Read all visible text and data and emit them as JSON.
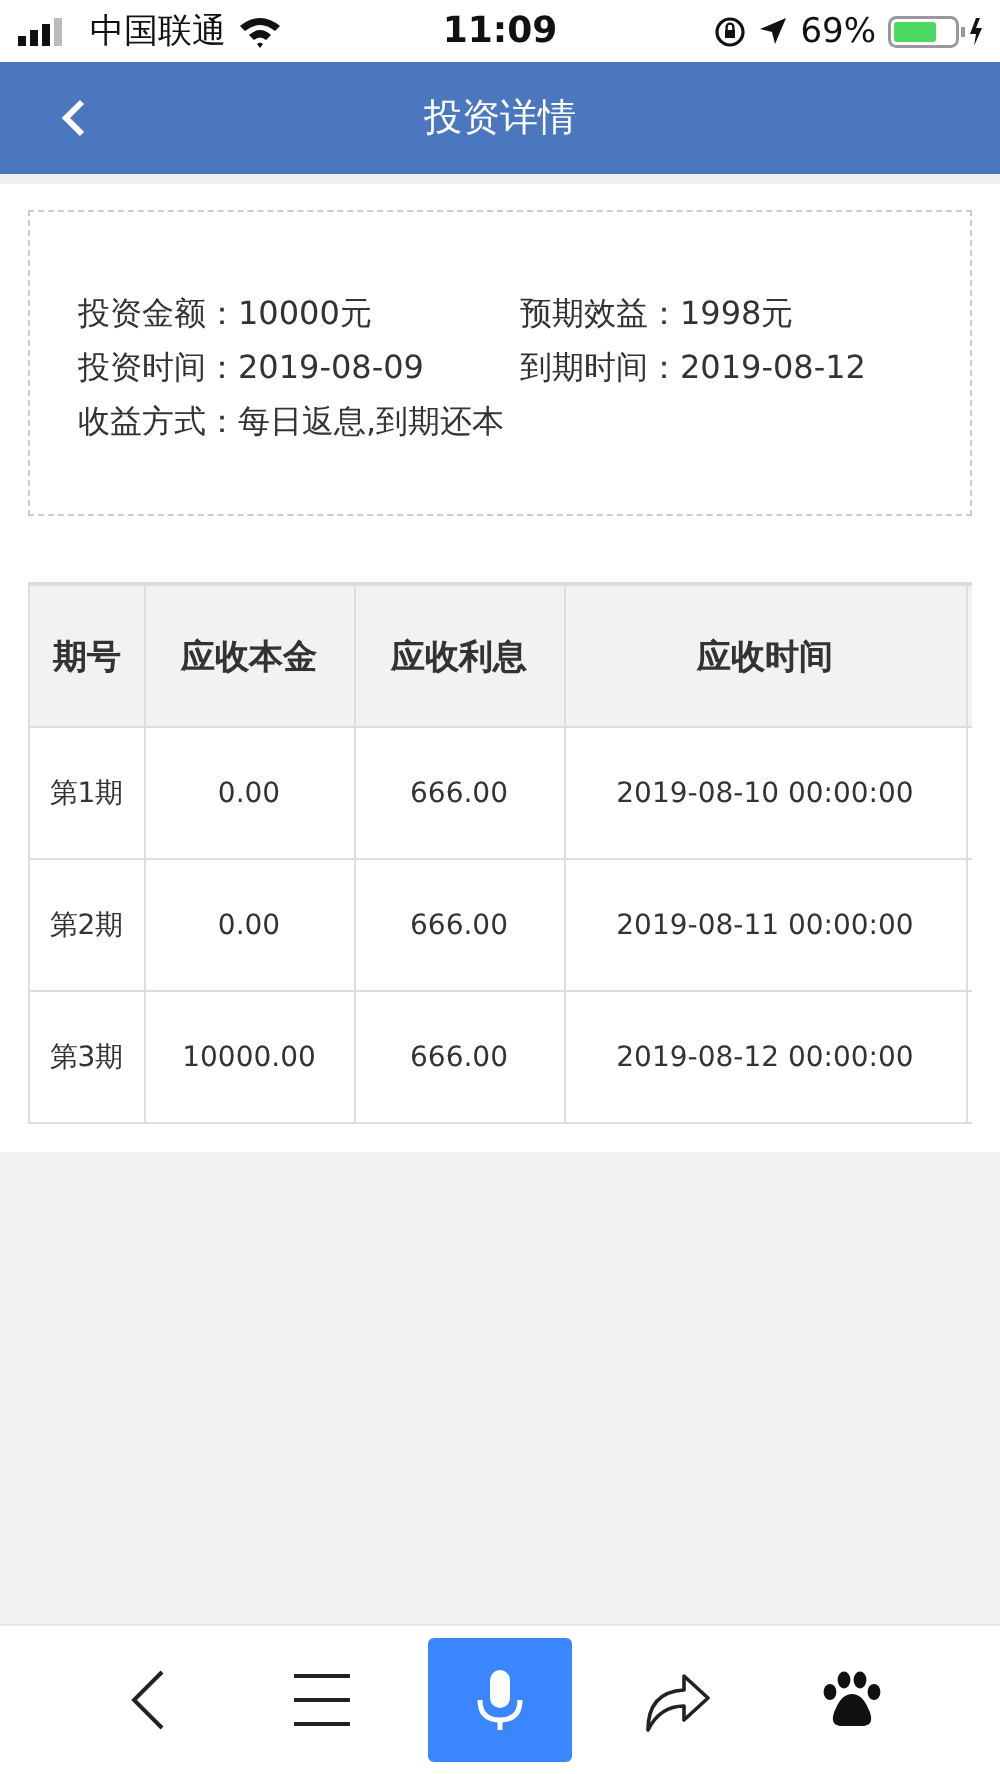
{
  "status_bar": {
    "carrier": "中国联通",
    "time": "11:09",
    "battery": "69%"
  },
  "nav": {
    "title": "投资详情"
  },
  "summary": [
    {
      "label": "投资金额：",
      "value": "10000元"
    },
    {
      "label": "预期效益：",
      "value": "1998元"
    },
    {
      "label": "投资时间：",
      "value": "2019-08-09"
    },
    {
      "label": "到期时间：",
      "value": "2019-08-12"
    },
    {
      "label": "收益方式：",
      "value": "每日返息,到期还本"
    }
  ],
  "table": {
    "columns": [
      "期号",
      "应收本金",
      "应收利息",
      "应收时间"
    ],
    "rows": [
      [
        "第1期",
        "0.00",
        "666.00",
        "2019-08-10 00:00:00"
      ],
      [
        "第2期",
        "0.00",
        "666.00",
        "2019-08-11 00:00:00"
      ],
      [
        "第3期",
        "10000.00",
        "666.00",
        "2019-08-12 00:00:00"
      ]
    ]
  }
}
